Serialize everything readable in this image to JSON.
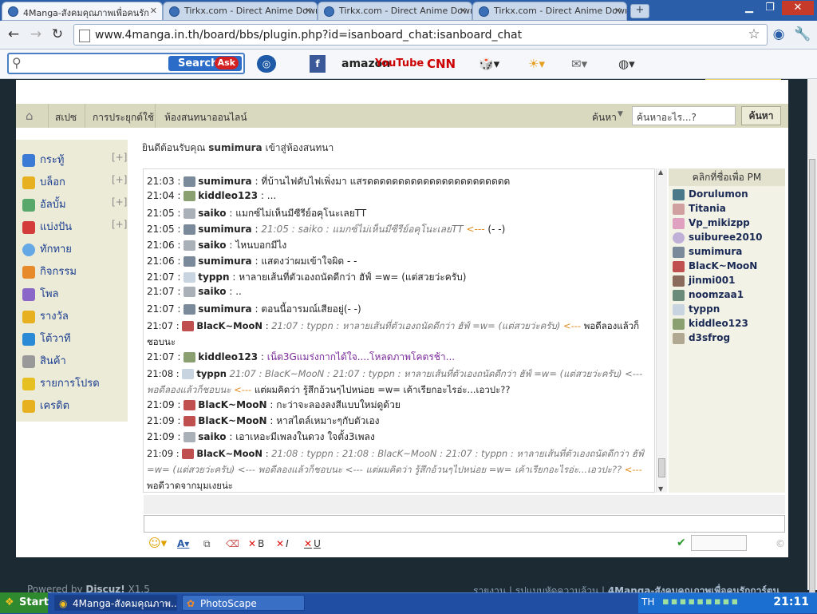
{
  "browser": {
    "tabs": [
      {
        "title": "4Manga-สังคมคุณภาพเพื่อคนรัก"
      },
      {
        "title": "Tirkx.com - Direct Anime Down"
      },
      {
        "title": "Tirkx.com - Direct Anime Down"
      },
      {
        "title": "Tirkx.com - Direct Anime Down"
      }
    ],
    "new_tab": "+",
    "url": "www.4manga.in.th/board/bbs/plugin.php?id=isanboard_chat:isanboard_chat"
  },
  "ask_toolbar": {
    "search_button": "Search",
    "ask_logo": "Ask",
    "brands": [
      "amazon",
      "YouTube",
      "CNN"
    ]
  },
  "breadcrumb": {
    "items": [
      "สเปซ",
      "การประยุกต์ใช้",
      "ห้องสนทนาออนไลน์"
    ],
    "search_label": "ค้นหา",
    "search_placeholder": "ค้นหาอะไร...?",
    "search_button": "ค้นหา"
  },
  "sidebar": {
    "items": [
      {
        "label": "กระทู้",
        "plus": "[+]",
        "color": "#3b7bd6"
      },
      {
        "label": "บล็อก",
        "plus": "[+]",
        "color": "#e6b020"
      },
      {
        "label": "อัลบั้ม",
        "plus": "[+]",
        "color": "#59a86b"
      },
      {
        "label": "แบ่งปัน",
        "plus": "[+]",
        "color": "#d43c3c"
      },
      {
        "label": "ทักทาย",
        "plus": "",
        "color": "#64a8e6"
      },
      {
        "label": "กิจกรรม",
        "plus": "",
        "color": "#e68a2a"
      },
      {
        "label": "โพล",
        "plus": "",
        "color": "#8a66c8"
      },
      {
        "label": "รางวัล",
        "plus": "",
        "color": "#e6b020"
      },
      {
        "label": "โต้วาที",
        "plus": "",
        "color": "#2a8ad6"
      },
      {
        "label": "สินค้า",
        "plus": "",
        "color": "#999999"
      },
      {
        "label": "รายการโปรด",
        "plus": "",
        "color": "#e6c020"
      },
      {
        "label": "เครดิต",
        "plus": "",
        "color": "#e6b020"
      }
    ]
  },
  "welcome": {
    "prefix": "ยินดีต้อนรับคุณ",
    "user": "sumimura",
    "suffix": "เข้าสู่ห้องสนทนา"
  },
  "chat": {
    "messages": [
      {
        "time": "21:03",
        "user": "sumimura",
        "text": "ที่บ้านไฟดับไฟเพิ่งมา แสรดดดดดดดดดดดดดดดดดดดดดดด"
      },
      {
        "time": "21:04",
        "user": "kiddleo123",
        "text": "..."
      },
      {
        "time": "21:05",
        "user": "saiko",
        "text": "แมกซ์ไม่เห็นมีซีรีย์อคุโนะเลยTT"
      },
      {
        "time": "21:05",
        "user": "sumimura",
        "quote": "21:05 : saiko : แมกซ์ไม่เห็นมีซีรีย์อคุโนะเลยTT",
        "arrow": "<---",
        "text": "(- -)"
      },
      {
        "time": "21:06",
        "user": "saiko",
        "text": "ไหนบอกมีไง"
      },
      {
        "time": "21:06",
        "user": "sumimura",
        "text": "แสดงว่าผมเข้าใจผิด - -"
      },
      {
        "time": "21:07",
        "user": "typpn",
        "text": "หาลายเส้นที่ตัวเองถนัดดีกว่า ฮัฟ์ =w= (แต่สวยว่ะครับ)"
      },
      {
        "time": "21:07",
        "user": "saiko",
        "text": ".."
      },
      {
        "time": "21:07",
        "user": "sumimura",
        "text": "ตอนนี้อารมณ์เสียอยู่(- -)"
      },
      {
        "time": "21:07",
        "user": "BlacK~MooN",
        "quote": "21:07 : typpn : หาลายเส้นที่ตัวเองถนัดดีกว่า ฮัฟ์ =w= (แต่สวยว่ะครับ)",
        "arrow": "<---",
        "text": "พอดีลองแล้วก็ชอบนะ"
      },
      {
        "time": "21:07",
        "user": "kiddleo123",
        "text": "เน็ต3Gแมร่งกากได้ใจ....โหลดภาพโคตรช้า..."
      },
      {
        "time": "21:08",
        "user": "typpn",
        "quote": "21:07 : BlacK~MooN : 21:07 : typpn : หาลายเส้นที่ตัวเองถนัดดีกว่า ฮัฟ์ =w= (แต่สวยว่ะครับ) <--- พอดีลองแล้วก็ชอบนะ",
        "arrow": "<---",
        "text": "แต่ผมคิดว่า รู้สึกอ้วนๆไปหน่อย =w= เค้าเรียกอะไรอ่ะ...เอวปะ??"
      },
      {
        "time": "21:09",
        "user": "BlacK~MooN",
        "text": "กะว่าจะลองลงสีแบบใหม่ดูด้วย"
      },
      {
        "time": "21:09",
        "user": "BlacK~MooN",
        "text": "หาสไตล์เหมาะๆกับตัวเอง"
      },
      {
        "time": "21:09",
        "user": "saiko",
        "text": "เอาเหอะมีเพลงในดวง ใจตั้ง3เพลง"
      },
      {
        "time": "21:09",
        "user": "BlacK~MooN",
        "quote": "21:08 : typpn : 21:08 : BlacK~MooN : 21:07 : typpn : หาลายเส้นที่ตัวเองถนัดดีกว่า ฮัฟ์ =w= (แต่สวยว่ะครับ) <--- พอดีลองแล้วก็ชอบนะ <--- แต่ผมคิดว่า รู้สึกอ้วนๆไปหน่อย =w= เค้าเรียกอะไรอ่ะ...เอวปะ??",
        "arrow": "<---",
        "text": "พอดีวาดจากมุมเงยน่ะ"
      }
    ]
  },
  "userlist": {
    "header": "คลิกที่ชื่อเพื่อ PM",
    "users": [
      "Dorulumon",
      "Titania",
      "Vp_mikizpp",
      "suiburee2010",
      "sumimura",
      "BlacK~MooN",
      "jinmi001",
      "noomzaa1",
      "typpn",
      "kiddleo123",
      "d3sfrog"
    ]
  },
  "editor": {
    "bold": "B",
    "italic": "I",
    "underline": "U",
    "copyright": "©"
  },
  "footer": {
    "powered_prefix": "Powered by",
    "brand": "Discuz!",
    "version": "X1.5",
    "links": "รายงาน | รูปแบบหัดความล้วน |",
    "site": "4Manga-สังคมคุณภาพเพื่อคนรักการ์ตูน"
  },
  "taskbar": {
    "start": "Start",
    "tasks": [
      "4Manga-สังคมคุณภาพ...",
      "PhotoScape"
    ],
    "lang": "TH",
    "clock": "21:11"
  }
}
